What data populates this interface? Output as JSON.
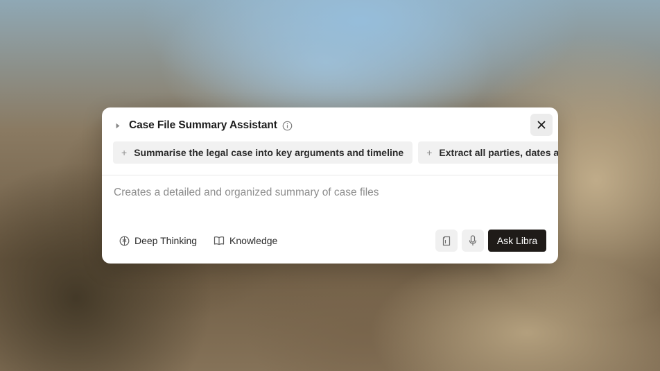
{
  "dialog": {
    "title": "Case File Summary Assistant",
    "close_icon": "close-icon",
    "info_icon": "info-icon",
    "expand_icon": "caret-right-icon"
  },
  "suggestions": [
    {
      "label": "Summarise the legal case into key arguments and timeline",
      "icon": "plus-icon"
    },
    {
      "label": "Extract all parties, dates and c",
      "icon": "plus-icon"
    }
  ],
  "input": {
    "placeholder": "Creates a detailed and organized summary of case files"
  },
  "footer": {
    "tools": [
      {
        "label": "Deep Thinking",
        "icon": "deep-thinking-icon"
      },
      {
        "label": "Knowledge",
        "icon": "book-icon"
      }
    ],
    "actions": {
      "attach_icon": "document-icon",
      "mic_icon": "microphone-icon",
      "submit_label": "Ask Libra"
    }
  },
  "colors": {
    "submit_bg": "#1f1b18",
    "chip_bg": "#f1f1f1",
    "placeholder": "#8c8c8c"
  }
}
